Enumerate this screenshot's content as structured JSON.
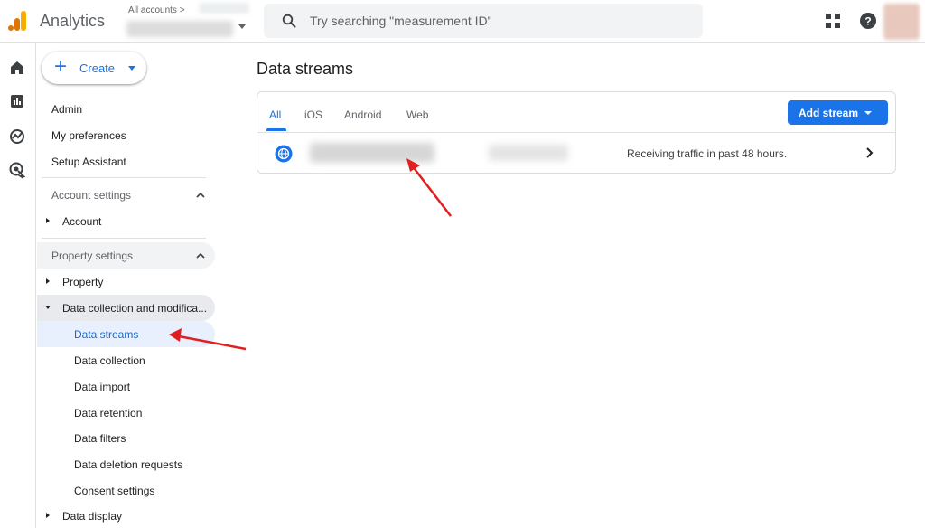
{
  "app": {
    "title": "Analytics",
    "brand_colors": [
      "#f9ab00",
      "#e37400"
    ]
  },
  "account_picker": {
    "label": "All accounts"
  },
  "search": {
    "placeholder": "Try searching \"measurement ID\""
  },
  "header_icons": [
    "apps-grid-icon",
    "help-icon",
    "avatar"
  ],
  "rail": {
    "items": [
      "home-icon",
      "reports-icon",
      "explore-icon",
      "advertising-icon"
    ]
  },
  "sidebar": {
    "create_label": "Create",
    "top_items": [
      "Admin",
      "My preferences",
      "Setup Assistant"
    ],
    "account_settings": {
      "label": "Account settings",
      "items": [
        "Account"
      ]
    },
    "property_settings": {
      "label": "Property settings",
      "property": "Property",
      "data_collection": "Data collection and modifica...",
      "sub_items": [
        "Data streams",
        "Data collection",
        "Data import",
        "Data retention",
        "Data filters",
        "Data deletion requests",
        "Consent settings"
      ],
      "data_display": "Data display"
    }
  },
  "main": {
    "title": "Data streams",
    "tabs": [
      "All",
      "iOS",
      "Android",
      "Web"
    ],
    "active_tab": "All",
    "add_stream_label": "Add stream",
    "streams": [
      {
        "icon": "globe-icon",
        "status": "Receiving traffic in past 48 hours."
      }
    ]
  },
  "colors": {
    "accent": "#1a73e8",
    "annotation_arrow": "#e02020"
  }
}
